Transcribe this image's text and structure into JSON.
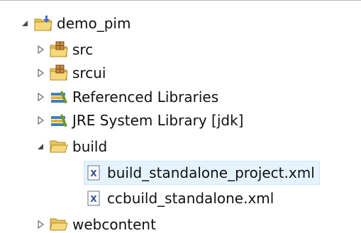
{
  "tree": {
    "items": [
      {
        "label": "demo_pim",
        "icon": "project-folder-icon",
        "twisty": "expanded"
      },
      {
        "label": "src",
        "icon": "package-folder-icon",
        "twisty": "collapsed"
      },
      {
        "label": "srcui",
        "icon": "package-folder-icon",
        "twisty": "collapsed"
      },
      {
        "label": "Referenced Libraries",
        "icon": "library-icon",
        "twisty": "collapsed"
      },
      {
        "label": "JRE System Library [jdk]",
        "icon": "library-icon",
        "twisty": "collapsed"
      },
      {
        "label": "build",
        "icon": "open-folder-icon",
        "twisty": "expanded"
      },
      {
        "label": "build_standalone_project.xml",
        "icon": "xml-file-icon",
        "selected": true
      },
      {
        "label": "ccbuild_standalone.xml",
        "icon": "xml-file-icon"
      },
      {
        "label": "webcontent",
        "icon": "open-folder-icon",
        "twisty": "collapsed"
      }
    ]
  },
  "colors": {
    "selection_bg": "#e5f3ff",
    "selection_border": "#cfe6fb",
    "folder": "#f2c94c",
    "library_books": "#3f7fbf",
    "twisty": "#4a4a4a"
  }
}
